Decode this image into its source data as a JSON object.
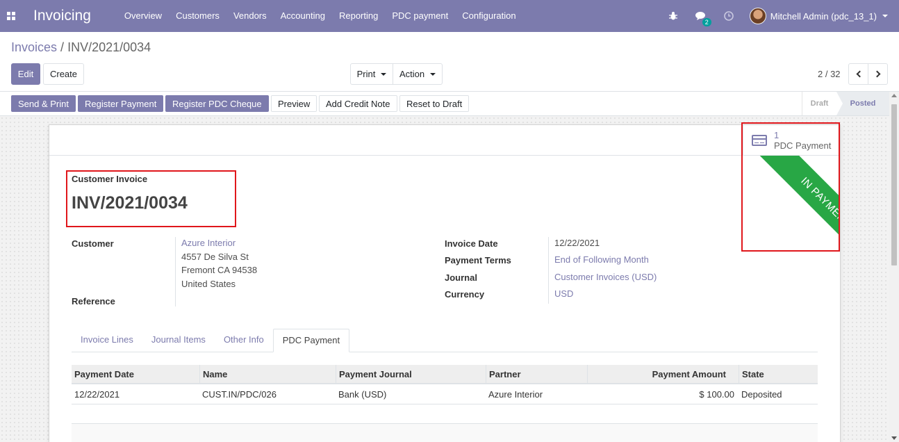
{
  "navbar": {
    "brand": "Invoicing",
    "menu": [
      "Overview",
      "Customers",
      "Vendors",
      "Accounting",
      "Reporting",
      "PDC payment",
      "Configuration"
    ],
    "messages_count": "2",
    "user": "Mitchell Admin (pdc_13_1)"
  },
  "breadcrumb": {
    "parent": "Invoices",
    "separator": " / ",
    "current": "INV/2021/0034"
  },
  "buttons": {
    "edit": "Edit",
    "create": "Create",
    "print": "Print",
    "action": "Action"
  },
  "pager": {
    "value": "2 / 32"
  },
  "statusbar": {
    "actions": [
      "Send & Print",
      "Register Payment",
      "Register PDC Cheque",
      "Preview",
      "Add Credit Note",
      "Reset to Draft"
    ],
    "stages": {
      "draft": "Draft",
      "posted": "Posted"
    }
  },
  "smart_button": {
    "count": "1",
    "label": "PDC Payment"
  },
  "ribbon": "IN PAYMENT",
  "invoice": {
    "type": "Customer Invoice",
    "name": "INV/2021/0034",
    "labels": {
      "customer": "Customer",
      "reference": "Reference",
      "invoice_date": "Invoice Date",
      "payment_terms": "Payment Terms",
      "journal": "Journal",
      "currency": "Currency"
    },
    "customer_name": "Azure Interior",
    "address": [
      "4557 De Silva St",
      "Fremont CA 94538",
      "United States"
    ],
    "invoice_date": "12/22/2021",
    "payment_terms": "End of Following Month",
    "journal": "Customer Invoices (USD)",
    "currency": "USD"
  },
  "tabs": [
    "Invoice Lines",
    "Journal Items",
    "Other Info",
    "PDC Payment"
  ],
  "table": {
    "headers": [
      "Payment Date",
      "Name",
      "Payment Journal",
      "Partner",
      "Payment Amount",
      "State"
    ],
    "rows": [
      [
        "12/22/2021",
        "CUST.IN/PDC/026",
        "Bank (USD)",
        "Azure Interior",
        "$ 100.00",
        "Deposited"
      ]
    ]
  },
  "colors": {
    "primary": "#7c7bad",
    "ribbon": "#28a745",
    "highlight": "#e0161b"
  }
}
